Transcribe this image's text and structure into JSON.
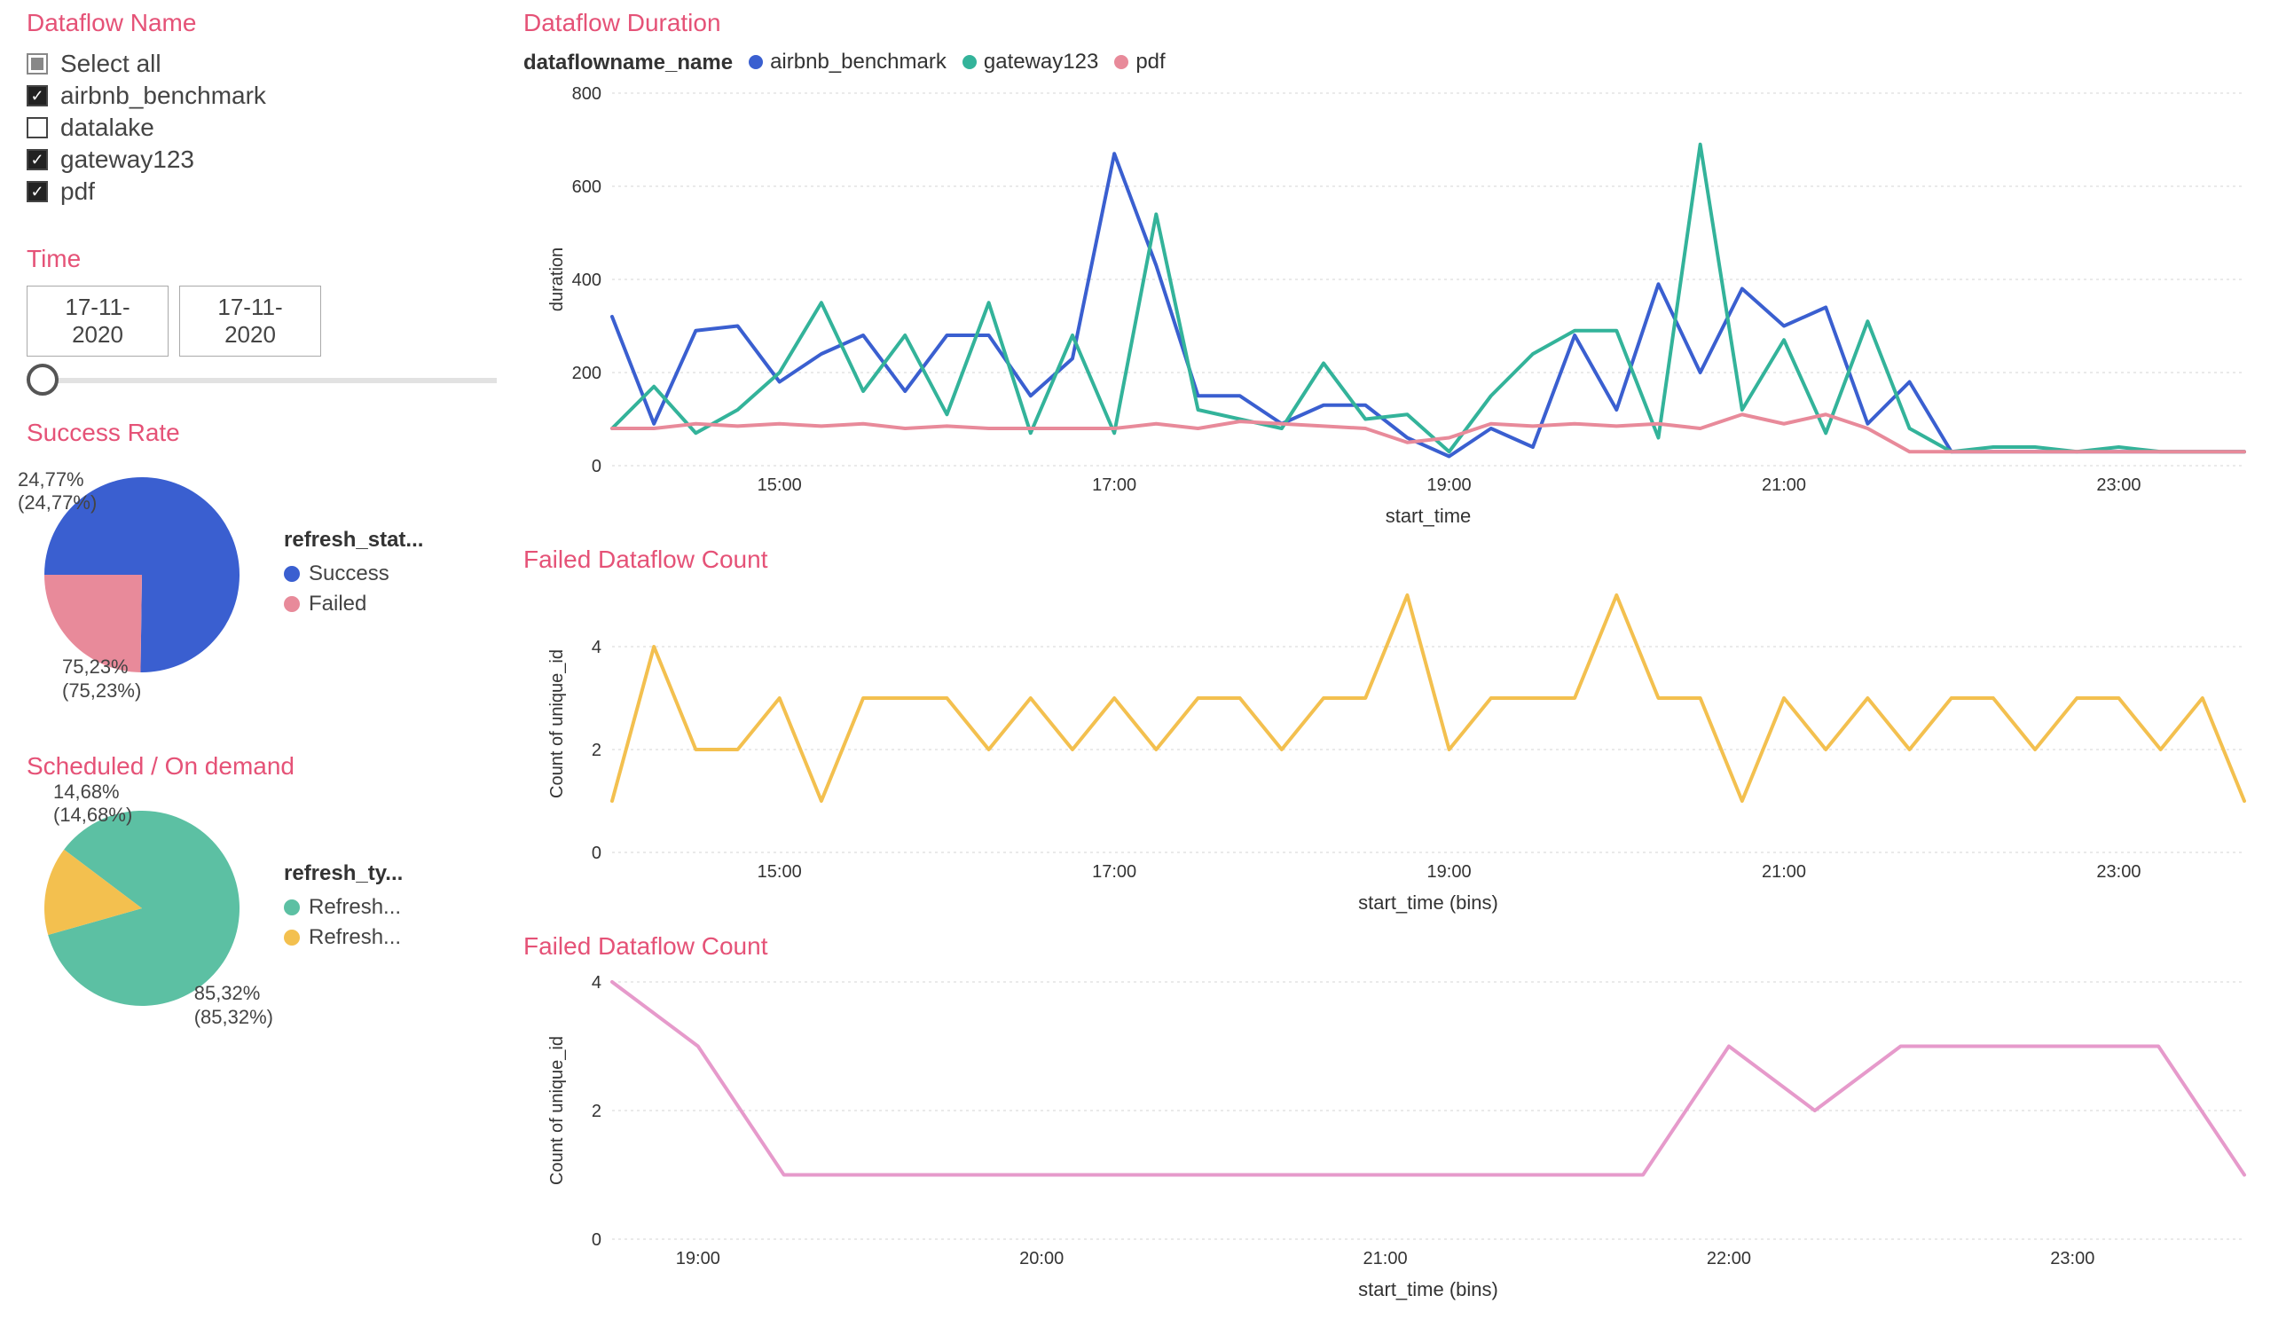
{
  "filters": {
    "name_title": "Dataflow Name",
    "items": [
      {
        "label": "Select all",
        "state": "partial"
      },
      {
        "label": "airbnb_benchmark",
        "state": "checked"
      },
      {
        "label": "datalake",
        "state": "unchecked"
      },
      {
        "label": "gateway123",
        "state": "checked"
      },
      {
        "label": "pdf",
        "state": "checked"
      }
    ],
    "time_title": "Time",
    "time_from": "17-11-2020",
    "time_to": "17-11-2020"
  },
  "pies": {
    "success": {
      "title": "Success Rate",
      "legend_title": "refresh_stat...",
      "legend": [
        {
          "label": "Success",
          "color": "#3a5fd0"
        },
        {
          "label": "Failed",
          "color": "#e88a9a"
        }
      ],
      "labels": {
        "a_top": "24,77%",
        "a_sub": "(24,77%)",
        "b_top": "75,23%",
        "b_sub": "(75,23%)"
      }
    },
    "schedule": {
      "title": "Scheduled / On demand",
      "legend_title": "refresh_ty...",
      "legend": [
        {
          "label": "Refresh...",
          "color": "#5cc0a3"
        },
        {
          "label": "Refresh...",
          "color": "#f3c04f"
        }
      ],
      "labels": {
        "a_top": "14,68%",
        "a_sub": "(14,68%)",
        "b_top": "85,32%",
        "b_sub": "(85,32%)"
      }
    }
  },
  "charts": {
    "duration": {
      "title": "Dataflow Duration",
      "legend_title": "dataflowname_name",
      "series_names": [
        "airbnb_benchmark",
        "gateway123",
        "pdf"
      ],
      "xlabel": "start_time",
      "ylabel": "duration"
    },
    "failed1": {
      "title": "Failed Dataflow Count",
      "xlabel": "start_time (bins)",
      "ylabel": "Count of unique_id"
    },
    "failed2": {
      "title": "Failed Dataflow Count",
      "xlabel": "start_time (bins)",
      "ylabel": "Count of unique_id"
    }
  },
  "colors": {
    "blue": "#3a5fd0",
    "teal": "#33b39a",
    "pink": "#e88a9a",
    "yellow": "#f3c04f",
    "violet": "#e69acb"
  },
  "chart_data": [
    {
      "type": "line",
      "title": "Dataflow Duration",
      "xlabel": "start_time",
      "ylabel": "duration",
      "ylim": [
        0,
        800
      ],
      "x_ticks": [
        "15:00",
        "17:00",
        "19:00",
        "21:00",
        "23:00"
      ],
      "x": [
        "14:00",
        "14:15",
        "14:30",
        "14:45",
        "15:00",
        "15:15",
        "15:30",
        "15:45",
        "16:00",
        "16:15",
        "16:30",
        "16:45",
        "17:00",
        "17:15",
        "17:30",
        "17:45",
        "18:00",
        "18:15",
        "18:30",
        "18:45",
        "19:00",
        "19:15",
        "19:30",
        "19:45",
        "20:00",
        "20:15",
        "20:30",
        "20:45",
        "21:00",
        "21:15",
        "21:30",
        "21:45",
        "22:00",
        "22:15",
        "22:30",
        "22:45",
        "23:00",
        "23:15",
        "23:30",
        "23:45"
      ],
      "series": [
        {
          "name": "airbnb_benchmark",
          "color": "#3a5fd0",
          "values": [
            320,
            90,
            290,
            300,
            180,
            240,
            280,
            160,
            280,
            280,
            150,
            230,
            670,
            430,
            150,
            150,
            90,
            130,
            130,
            60,
            20,
            80,
            40,
            280,
            120,
            390,
            200,
            380,
            300,
            340,
            90,
            180,
            30,
            30,
            30,
            30,
            30,
            30,
            30,
            30
          ]
        },
        {
          "name": "gateway123",
          "color": "#33b39a",
          "values": [
            80,
            170,
            70,
            120,
            200,
            350,
            160,
            280,
            110,
            350,
            70,
            280,
            70,
            540,
            120,
            100,
            80,
            220,
            100,
            110,
            30,
            150,
            240,
            290,
            290,
            60,
            690,
            120,
            270,
            70,
            310,
            80,
            30,
            40,
            40,
            30,
            40,
            30,
            30,
            30
          ]
        },
        {
          "name": "pdf",
          "color": "#e88a9a",
          "values": [
            80,
            80,
            90,
            85,
            90,
            85,
            90,
            80,
            85,
            80,
            80,
            80,
            80,
            90,
            80,
            95,
            90,
            85,
            80,
            50,
            60,
            90,
            85,
            90,
            85,
            90,
            80,
            110,
            90,
            110,
            80,
            30,
            30,
            30,
            30,
            30,
            30,
            30,
            30,
            30
          ]
        }
      ]
    },
    {
      "type": "line",
      "title": "Failed Dataflow Count",
      "xlabel": "start_time (bins)",
      "ylabel": "Count of unique_id",
      "ylim": [
        0,
        5
      ],
      "y_ticks": [
        0,
        2,
        4
      ],
      "x_ticks": [
        "15:00",
        "17:00",
        "19:00",
        "21:00",
        "23:00"
      ],
      "x": [
        "14:00",
        "14:15",
        "14:30",
        "14:45",
        "15:00",
        "15:15",
        "15:30",
        "15:45",
        "16:00",
        "16:15",
        "16:30",
        "16:45",
        "17:00",
        "17:15",
        "17:30",
        "17:45",
        "18:00",
        "18:15",
        "18:30",
        "18:45",
        "19:00",
        "19:15",
        "19:30",
        "19:45",
        "20:00",
        "20:15",
        "20:30",
        "20:45",
        "21:00",
        "21:15",
        "21:30",
        "21:45",
        "22:00",
        "22:15",
        "22:30",
        "22:45",
        "23:00",
        "23:15",
        "23:30",
        "23:45"
      ],
      "series": [
        {
          "name": "failed",
          "color": "#f3c04f",
          "values": [
            1,
            4,
            2,
            2,
            3,
            1,
            3,
            3,
            3,
            2,
            3,
            2,
            3,
            2,
            3,
            3,
            2,
            3,
            3,
            5,
            2,
            3,
            3,
            3,
            5,
            3,
            3,
            1,
            3,
            2,
            3,
            2,
            3,
            3,
            2,
            3,
            3,
            2,
            3,
            1
          ]
        }
      ]
    },
    {
      "type": "line",
      "title": "Failed Dataflow Count",
      "xlabel": "start_time (bins)",
      "ylabel": "Count of unique_id",
      "ylim": [
        0,
        4
      ],
      "y_ticks": [
        0,
        2,
        4
      ],
      "x_ticks": [
        "19:00",
        "20:00",
        "21:00",
        "22:00",
        "23:00"
      ],
      "x": [
        "18:45",
        "19:00",
        "19:15",
        "19:30",
        "19:45",
        "20:00",
        "20:15",
        "20:30",
        "20:45",
        "21:00",
        "21:15",
        "21:30",
        "21:45",
        "22:00",
        "22:15",
        "22:30",
        "22:45",
        "23:00",
        "23:15",
        "23:30"
      ],
      "series": [
        {
          "name": "failed",
          "color": "#e69acb",
          "values": [
            4,
            3,
            1,
            1,
            1,
            1,
            1,
            1,
            1,
            1,
            1,
            1,
            1,
            3,
            2,
            3,
            3,
            3,
            3,
            1
          ]
        }
      ]
    },
    {
      "type": "pie",
      "title": "Success Rate",
      "series": [
        {
          "name": "Success",
          "value": 75.23,
          "color": "#3a5fd0"
        },
        {
          "name": "Failed",
          "value": 24.77,
          "color": "#e88a9a"
        }
      ]
    },
    {
      "type": "pie",
      "title": "Scheduled / On demand",
      "series": [
        {
          "name": "Refresh...",
          "value": 85.32,
          "color": "#5cc0a3"
        },
        {
          "name": "Refresh...",
          "value": 14.68,
          "color": "#f3c04f"
        }
      ]
    }
  ]
}
